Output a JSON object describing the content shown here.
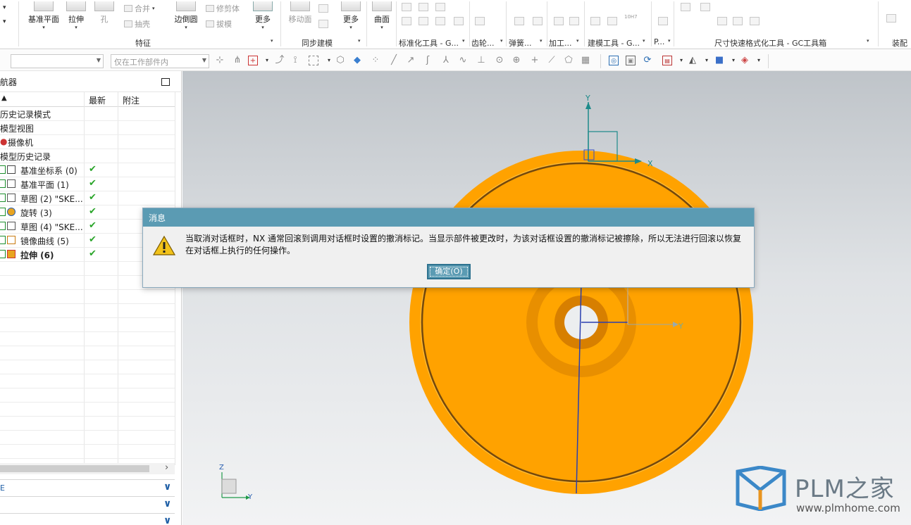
{
  "ribbon": {
    "buttons": [
      {
        "label": "基准平面",
        "arrow": "▾"
      },
      {
        "label": "拉伸",
        "arrow": "▾"
      },
      {
        "label": "孔"
      },
      {
        "label": "边倒圆",
        "arrow": "▾"
      },
      {
        "label": "更多",
        "arrow": "▾"
      },
      {
        "label": "移动面"
      },
      {
        "label": "更多",
        "arrow": "▾"
      },
      {
        "label": "曲面",
        "arrow": "▾"
      }
    ],
    "small": [
      "合并",
      "抽壳",
      "修剪体",
      "拔模"
    ],
    "groups": [
      {
        "label": "特征"
      },
      {
        "label": "同步建模"
      },
      {
        "label": "标准化工具 - G..."
      },
      {
        "label": "齿轮..."
      },
      {
        "label": "弹簧..."
      },
      {
        "label": "加工..."
      },
      {
        "label": "建模工具 - G..."
      },
      {
        "label": "P..."
      },
      {
        "label": "尺寸快速格式化工具 - GC工具箱"
      },
      {
        "label": "装配"
      }
    ],
    "spinner_label": "10H7"
  },
  "toolbar": {
    "filter_value": "",
    "scope_value": "仅在工作部件内"
  },
  "navigator": {
    "title": "航器",
    "columns": [
      "",
      "最新",
      "附注"
    ],
    "rows": [
      {
        "label": "历史记录模式",
        "check": ""
      },
      {
        "label": "模型视图",
        "check": ""
      },
      {
        "label": "摄像机",
        "check": ""
      },
      {
        "label": "模型历史记录",
        "check": ""
      },
      {
        "label": "基准坐标系 (0)",
        "check": "✔"
      },
      {
        "label": "基准平面 (1)",
        "check": "✔"
      },
      {
        "label": "草图 (2) \"SKE...",
        "check": "✔"
      },
      {
        "label": "旋转 (3)",
        "check": "✔"
      },
      {
        "label": "草图 (4) \"SKE...",
        "check": "✔"
      },
      {
        "label": "镜像曲线 (5)",
        "check": "✔"
      },
      {
        "label": "拉伸 (6)",
        "check": "✔"
      }
    ],
    "panels": [
      {
        "label": "E",
        "chevron": "∨"
      },
      {
        "label": "",
        "chevron": "∨"
      },
      {
        "label": "",
        "chevron": "∨"
      }
    ],
    "scroll_arrow": "›"
  },
  "viewport": {
    "axis_labels": {
      "x": "X",
      "y": "Y",
      "y2": "Y",
      "z": "Z",
      "y3": "Y"
    },
    "colors": {
      "part": "#ffa500",
      "part_edge": "#e68a00",
      "axis_teal": "#1d8a8a",
      "axis_blue": "#2a3fb0"
    }
  },
  "dialog": {
    "title": "消息",
    "message": "当取消对话框时，NX 通常回滚到调用对话框时设置的撤消标记。当显示部件被更改时，为该对话框设置的撤消标记被擦除，所以无法进行回滚以恢复在对话框上执行的任何操作。",
    "ok_label": "确定(O)",
    "icon": "warning-icon"
  },
  "watermark": {
    "brand": "PLM之家",
    "url": "www.plmhome.com"
  }
}
